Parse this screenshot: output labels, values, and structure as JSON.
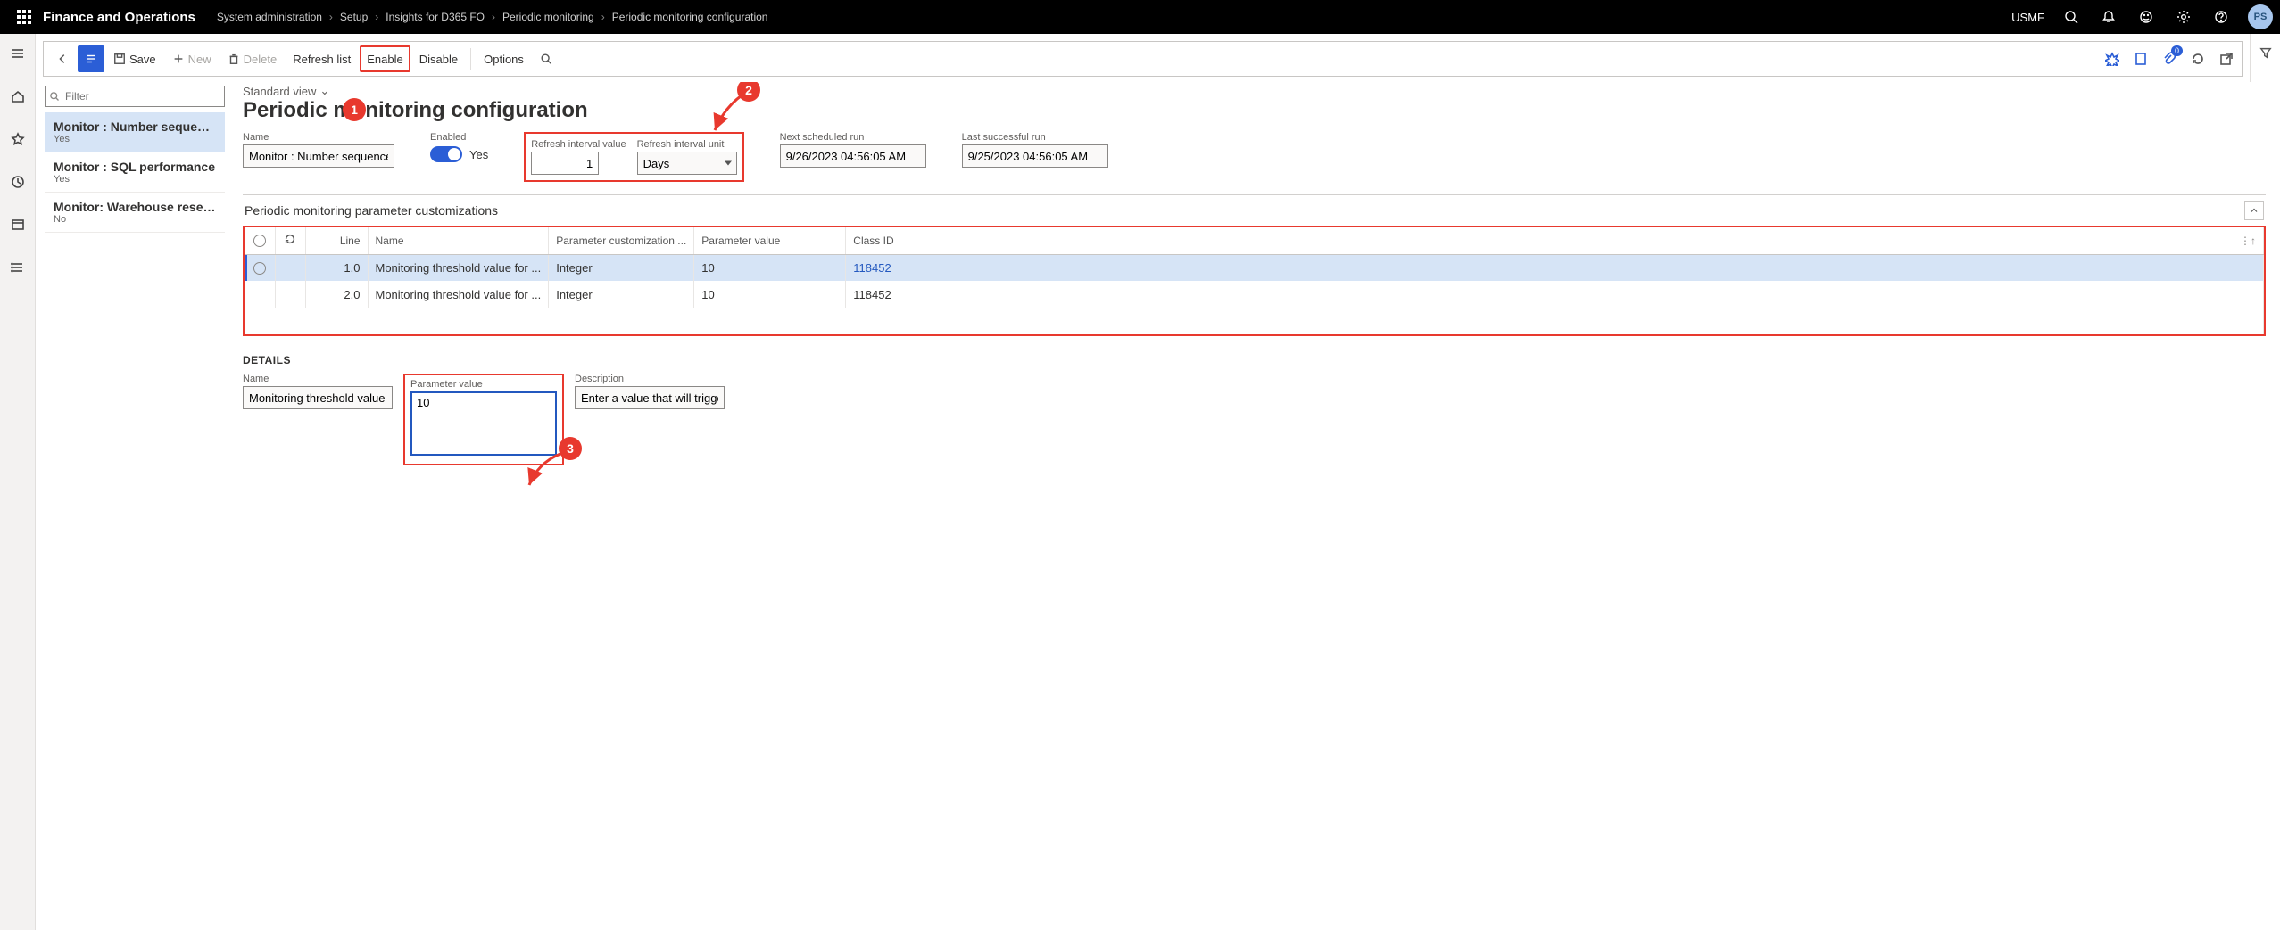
{
  "header": {
    "appTitle": "Finance and Operations",
    "breadcrumbs": [
      "System administration",
      "Setup",
      "Insights for D365 FO",
      "Periodic monitoring",
      "Periodic monitoring configuration"
    ],
    "company": "USMF",
    "avatar": "PS",
    "docCount": "0"
  },
  "actionBar": {
    "save": "Save",
    "new": "New",
    "delete": "Delete",
    "refreshList": "Refresh list",
    "enable": "Enable",
    "disable": "Disable",
    "options": "Options"
  },
  "leftList": {
    "filterPlaceholder": "Filter",
    "items": [
      {
        "title": "Monitor : Number sequences",
        "sub": "Yes"
      },
      {
        "title": "Monitor : SQL performance",
        "sub": "Yes"
      },
      {
        "title": "Monitor: Warehouse reserva...",
        "sub": "No"
      }
    ]
  },
  "form": {
    "viewPicker": "Standard view",
    "pageTitle": "Periodic monitoring configuration",
    "nameLabel": "Name",
    "name": "Monitor : Number sequences",
    "enabledLabel": "Enabled",
    "enabledText": "Yes",
    "refreshValLabel": "Refresh interval value",
    "refreshVal": "1",
    "refreshUnitLabel": "Refresh interval unit",
    "refreshUnit": "Days",
    "nextRunLabel": "Next scheduled run",
    "nextRun": "9/26/2023 04:56:05 AM",
    "lastRunLabel": "Last successful run",
    "lastRun": "9/25/2023 04:56:05 AM",
    "fastTab": "Periodic monitoring parameter customizations",
    "columns": {
      "line": "Line",
      "name": "Name",
      "paramCust": "Parameter customization ...",
      "paramVal": "Parameter value",
      "classId": "Class ID"
    },
    "rows": [
      {
        "line": "1.0",
        "name": "Monitoring threshold value for ...",
        "paramCust": "Integer",
        "paramVal": "10",
        "classId": "118452"
      },
      {
        "line": "2.0",
        "name": "Monitoring threshold value for ...",
        "paramCust": "Integer",
        "paramVal": "10",
        "classId": "118452"
      }
    ],
    "details": {
      "heading": "DETAILS",
      "nameLabel": "Name",
      "name": "Monitoring threshold value for ...",
      "paramLabel": "Parameter value",
      "paramVal": "10",
      "descLabel": "Description",
      "desc": "Enter a value that will trigger an..."
    }
  },
  "callouts": {
    "c1": "1",
    "c2": "2",
    "c3": "3"
  }
}
